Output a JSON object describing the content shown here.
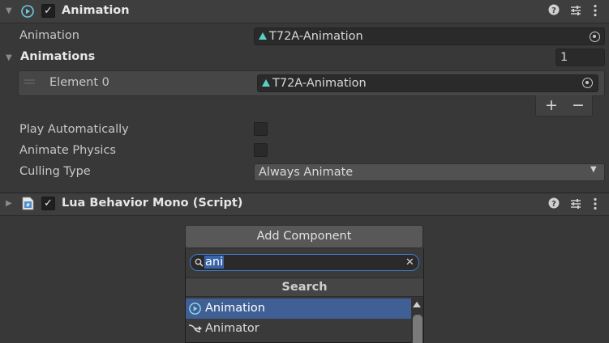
{
  "animation_component": {
    "title": "Animation",
    "enabled": true,
    "animation_label": "Animation",
    "animation_value": "T72A-Animation",
    "animations_label": "Animations",
    "animations_count": "1",
    "elements": [
      {
        "label": "Element 0",
        "value": "T72A-Animation"
      }
    ],
    "add_symbol": "+",
    "remove_symbol": "−",
    "play_automatically_label": "Play Automatically",
    "play_automatically": false,
    "animate_physics_label": "Animate Physics",
    "animate_physics": false,
    "culling_type_label": "Culling Type",
    "culling_type_value": "Always Animate"
  },
  "lua_component": {
    "title": "Lua Behavior Mono (Script)",
    "enabled": true
  },
  "add_component": {
    "button_label": "Add Component",
    "search_value": "ani",
    "search_header": "Search",
    "results": [
      {
        "label": "Animation",
        "icon": "animation-icon",
        "selected": true
      },
      {
        "label": "Animator",
        "icon": "animator-icon",
        "selected": false
      }
    ]
  },
  "colors": {
    "background": "#383838",
    "header": "#3e3e3e",
    "selection": "#3f5f95",
    "clip_accent": "#59d2c6"
  }
}
